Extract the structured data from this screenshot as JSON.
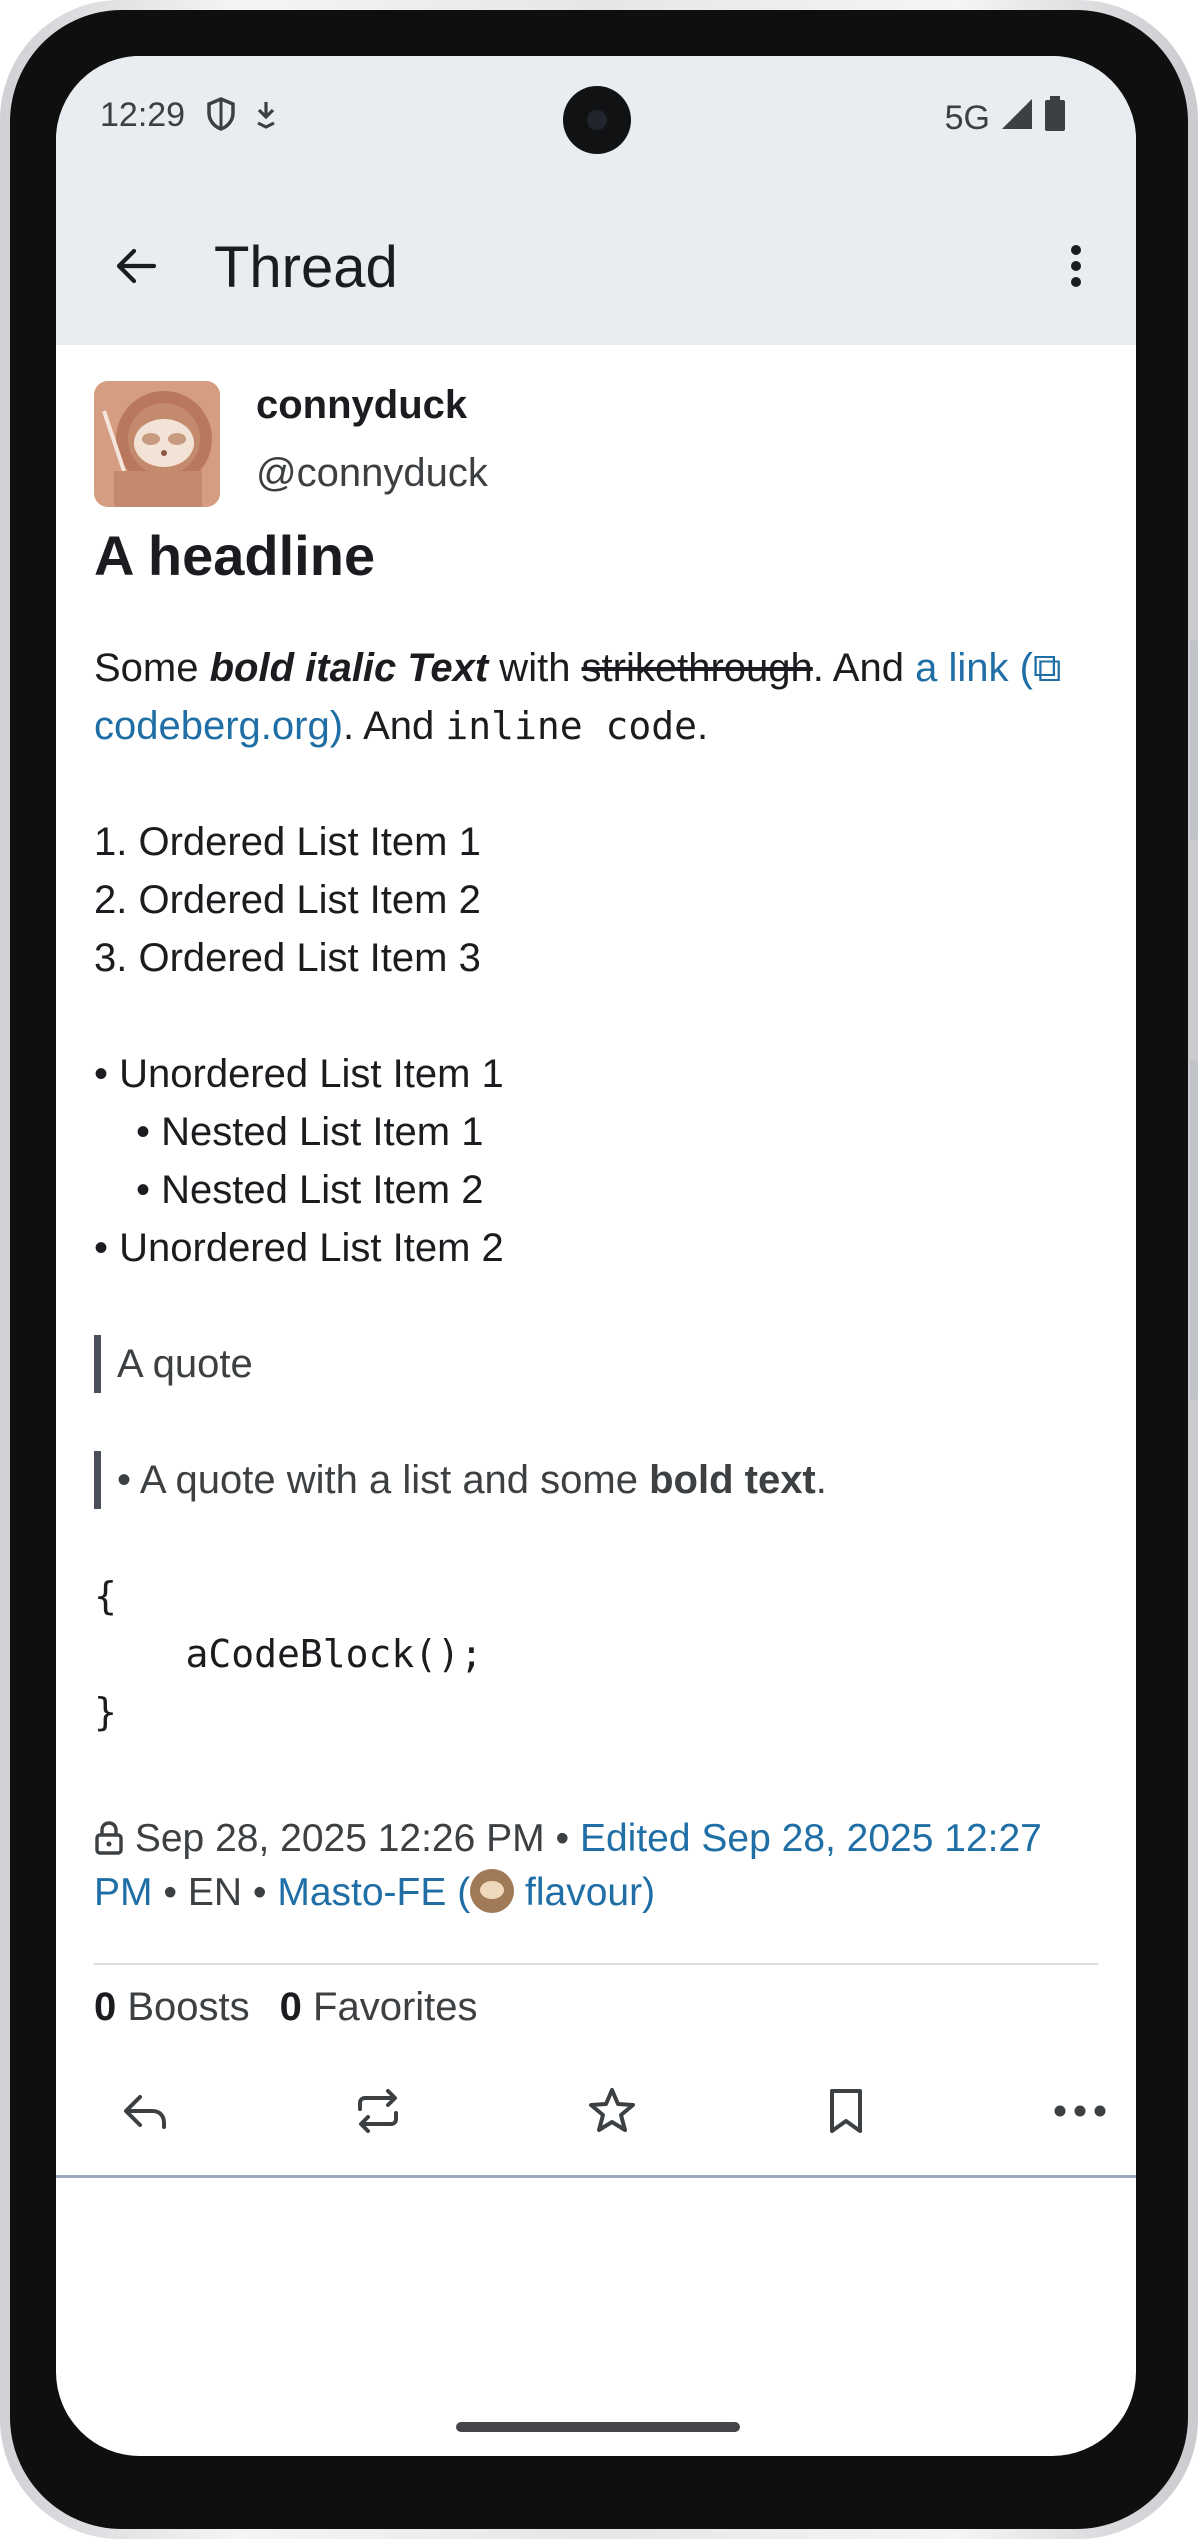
{
  "status_bar": {
    "time": "12:29",
    "network": "5G",
    "icons": [
      "shield-icon",
      "download-icon",
      "signal-icon",
      "battery-icon"
    ]
  },
  "app_bar": {
    "title": "Thread",
    "back_icon": "arrow-back-icon",
    "menu_icon": "more-vert-icon"
  },
  "post": {
    "display_name": "connyduck",
    "username": "@connyduck",
    "headline": "A headline",
    "para": {
      "t1": "Some ",
      "bold_italic": "bold italic",
      "t2": " ",
      "italic_bold": "Text",
      "t3": " with ",
      "strike": "strikethrough",
      "t4": ". And ",
      "link": "a link",
      "link_domain": "(⧉ codeberg.org)",
      "t5": ". And ",
      "code": "inline code",
      "t6": "."
    },
    "ordered_list": [
      "1. Ordered List Item 1",
      "2. Ordered List Item 2",
      "3. Ordered List Item 3"
    ],
    "unordered_list": [
      {
        "text": "• Unordered List Item 1",
        "nested": false
      },
      {
        "text": "• Nested List Item 1",
        "nested": true
      },
      {
        "text": "• Nested List Item 2",
        "nested": true
      },
      {
        "text": "• Unordered List Item 2",
        "nested": false
      }
    ],
    "quote1": "A quote",
    "quote2": {
      "prefix": "• A quote with a list and some ",
      "bold": "bold text",
      "suffix": "."
    },
    "code_block": [
      "{",
      "    aCodeBlock();",
      "}"
    ],
    "meta": {
      "date": "Sep 28, 2025 12:26 PM",
      "sep1": " • ",
      "edited": "Edited Sep 28, 2025 12:27 PM",
      "sep2": " • EN • ",
      "client_a": "Masto-FE (",
      "client_b": " flavour)"
    },
    "counts": {
      "boosts_num": "0",
      "boosts_label": "Boosts",
      "favorites_num": "0",
      "favorites_label": "Favorites"
    },
    "actions": [
      "reply-icon",
      "boost-icon",
      "favorite-icon",
      "bookmark-icon",
      "more-horiz-icon"
    ]
  },
  "colors": {
    "link": "#1f6fa6",
    "app_bar_bg": "#e9edf2",
    "text": "#1b1c1f"
  }
}
